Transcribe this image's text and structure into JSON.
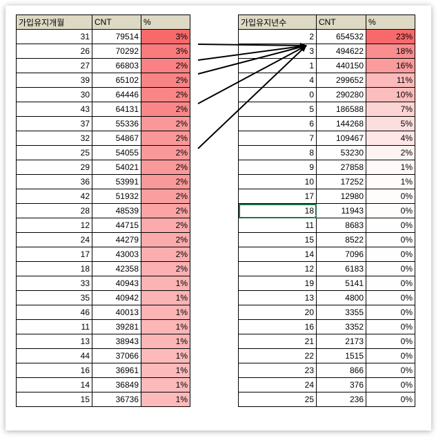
{
  "left_table": {
    "headers": [
      "가입유지개월",
      "CNT",
      "%"
    ],
    "rows": [
      [
        "31",
        "79514",
        "3%"
      ],
      [
        "26",
        "70292",
        "3%"
      ],
      [
        "27",
        "66803",
        "2%"
      ],
      [
        "39",
        "65102",
        "2%"
      ],
      [
        "30",
        "64446",
        "2%"
      ],
      [
        "43",
        "64131",
        "2%"
      ],
      [
        "37",
        "55336",
        "2%"
      ],
      [
        "32",
        "54867",
        "2%"
      ],
      [
        "25",
        "54055",
        "2%"
      ],
      [
        "29",
        "54021",
        "2%"
      ],
      [
        "36",
        "53991",
        "2%"
      ],
      [
        "42",
        "51932",
        "2%"
      ],
      [
        "28",
        "48539",
        "2%"
      ],
      [
        "12",
        "44715",
        "2%"
      ],
      [
        "24",
        "44279",
        "2%"
      ],
      [
        "17",
        "43003",
        "2%"
      ],
      [
        "18",
        "42358",
        "2%"
      ],
      [
        "33",
        "40943",
        "1%"
      ],
      [
        "35",
        "40942",
        "1%"
      ],
      [
        "46",
        "40013",
        "1%"
      ],
      [
        "11",
        "39281",
        "1%"
      ],
      [
        "13",
        "38943",
        "1%"
      ],
      [
        "44",
        "37066",
        "1%"
      ],
      [
        "16",
        "36961",
        "1%"
      ],
      [
        "14",
        "36849",
        "1%"
      ],
      [
        "15",
        "36736",
        "1%"
      ]
    ],
    "shading": [
      1.0,
      0.88,
      0.84,
      0.82,
      0.81,
      0.8,
      0.69,
      0.69,
      0.68,
      0.68,
      0.68,
      0.65,
      0.61,
      0.56,
      0.56,
      0.54,
      0.53,
      0.51,
      0.51,
      0.5,
      0.49,
      0.49,
      0.46,
      0.46,
      0.46,
      0.46
    ]
  },
  "right_table": {
    "headers": [
      "가입유지년수",
      "CNT",
      "%"
    ],
    "rows": [
      [
        "2",
        "654532",
        "23%"
      ],
      [
        "3",
        "494622",
        "18%"
      ],
      [
        "1",
        "440150",
        "16%"
      ],
      [
        "4",
        "299652",
        "11%"
      ],
      [
        "0",
        "290280",
        "10%"
      ],
      [
        "5",
        "186588",
        "7%"
      ],
      [
        "6",
        "144268",
        "5%"
      ],
      [
        "7",
        "109467",
        "4%"
      ],
      [
        "8",
        "53230",
        "2%"
      ],
      [
        "9",
        "27858",
        "1%"
      ],
      [
        "10",
        "17252",
        "1%"
      ],
      [
        "17",
        "12980",
        "0%"
      ],
      [
        "18",
        "11943",
        "0%"
      ],
      [
        "11",
        "8683",
        "0%"
      ],
      [
        "15",
        "8522",
        "0%"
      ],
      [
        "14",
        "7096",
        "0%"
      ],
      [
        "12",
        "6183",
        "0%"
      ],
      [
        "19",
        "5141",
        "0%"
      ],
      [
        "13",
        "4800",
        "0%"
      ],
      [
        "20",
        "3355",
        "0%"
      ],
      [
        "16",
        "3352",
        "0%"
      ],
      [
        "21",
        "2173",
        "0%"
      ],
      [
        "22",
        "1515",
        "0%"
      ],
      [
        "23",
        "866",
        "0%"
      ],
      [
        "24",
        "376",
        "0%"
      ],
      [
        "25",
        "236",
        "0%"
      ]
    ],
    "shading": [
      1.0,
      0.76,
      0.67,
      0.46,
      0.44,
      0.29,
      0.22,
      0.17,
      0.08,
      0.04,
      0.03,
      0.02,
      0.02,
      0.01,
      0.01,
      0.01,
      0.01,
      0.01,
      0.01,
      0.0,
      0.0,
      0.0,
      0.0,
      0.0,
      0.0,
      0.0
    ],
    "selected_row": 12
  },
  "colors": {
    "header_bg": "#ddd9c4",
    "bar_base": "#f8696b",
    "selection": "#217346"
  }
}
